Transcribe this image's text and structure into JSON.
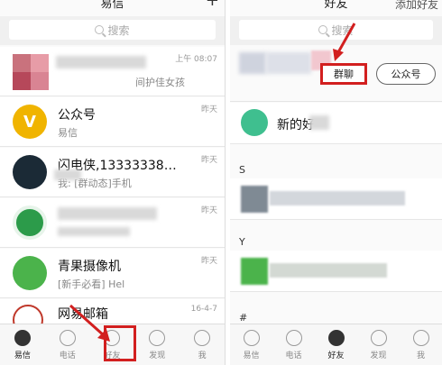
{
  "left": {
    "title": "易信",
    "plus": "+",
    "search_placeholder": "搜索",
    "conversations": [
      {
        "name": "",
        "preview": "间护佳女孩",
        "time": "上午 08:07"
      },
      {
        "name": "公众号",
        "preview": "易信",
        "time": "昨天"
      },
      {
        "name": "闪电侠,13333338…",
        "preview": "我: [群动态]手机",
        "time": "昨天"
      },
      {
        "name": "",
        "preview": "",
        "time": "昨天"
      },
      {
        "name": "青果摄像机",
        "preview": "[新手必看] Hel",
        "time": "昨天"
      },
      {
        "name": "网易邮箱",
        "preview": "",
        "time": "16-4-7"
      }
    ],
    "avatar_letter": "V",
    "tabs": [
      "易信",
      "电话",
      "好友",
      "发现",
      "我"
    ],
    "active_tab": "好友",
    "highlight_tab": "好友"
  },
  "right": {
    "title": "好友",
    "add_friend": "添加好友",
    "search_placeholder": "搜索",
    "segments": [
      "群聊",
      "公众号"
    ],
    "highlight_segment": "群聊",
    "new_friends": "新的好",
    "sections": [
      "S",
      "Y",
      "#"
    ],
    "tabs": [
      "易信",
      "电话",
      "好友",
      "发现",
      "我"
    ],
    "active_tab": "好友"
  },
  "colors": {
    "highlight": "#d21f1f",
    "yixin_green": "#4bb34b",
    "gongzhong_yellow": "#f0b400"
  }
}
